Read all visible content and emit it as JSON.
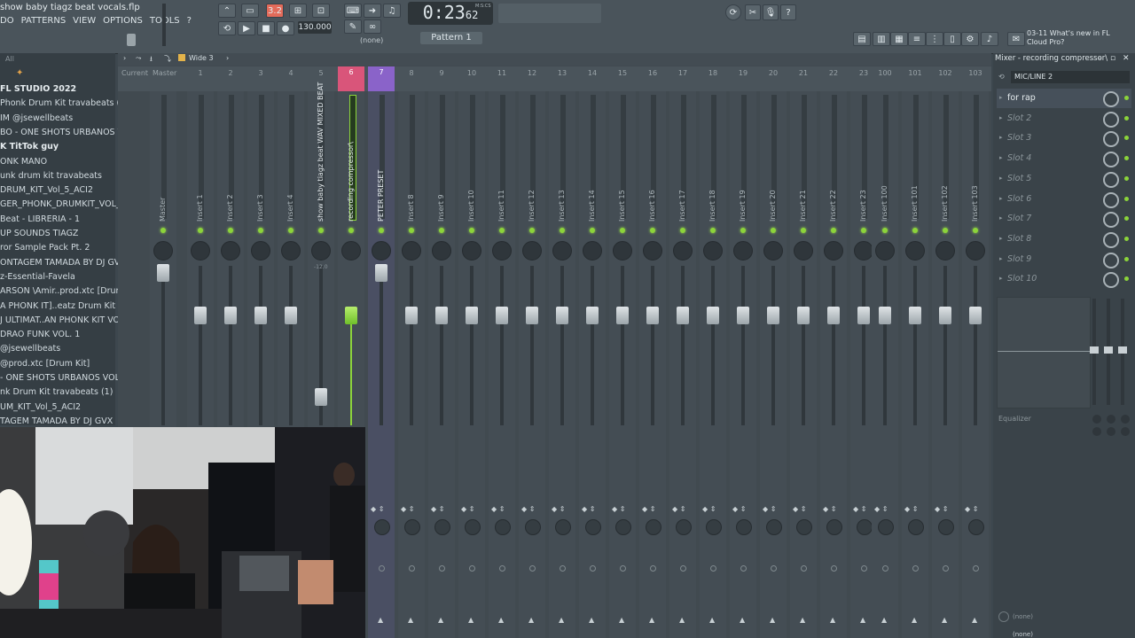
{
  "window": {
    "file_title": "show baby tiagz beat vocals.flp",
    "menu": [
      "DO",
      "PATTERNS",
      "VIEW",
      "OPTIONS",
      "TOOLS",
      "?"
    ]
  },
  "transport": {
    "time_main": "0:23",
    "time_sub": "62",
    "time_unit": "M:S:CS",
    "tempo": "130.000",
    "pattern": "Pattern 1",
    "snap": "(none)"
  },
  "news": {
    "line1": "03-11  What's new in FL",
    "line2": "Cloud Pro?"
  },
  "browser": {
    "header": "All",
    "items": [
      "FL STUDIO 2022",
      "Phonk Drum Kit travabeats (1)",
      "IM @jsewellbeats",
      "BO - ONE SHOTS URBANOS VOL. 2",
      "K TitTok guy",
      "ONK MANO",
      "unk drum kit travabeats",
      "DRUM_KIT_Vol_5_ACI2",
      "GER_PHONK_DRUMKIT_VOL_3",
      "Beat - LIBRERIA - 1",
      "UP SOUNDS TIAGZ",
      "ror Sample Pack Pt. 2",
      "ONTAGEM TAMADA BY DJ GVX",
      "z-Essential-Favela",
      "ARSON \\Amir..prod.xtc [Drum Kit]",
      "A PHONK IT]..eatz Drum Kit vol 1",
      "J ULTIMAT..AN PHONK KIT VOL. 3",
      "DRAO FUNK VOL. 1",
      "@jsewellbeats",
      "@prod.xtc [Drum Kit]",
      "- ONE SHOTS URBANOS VOL. 2",
      "nk Drum Kit travabeats (1)",
      "UM_KIT_Vol_5_ACI2",
      "TAGEM TAMADA BY DJ GVX"
    ]
  },
  "mixer": {
    "layout_label": "Wide 3",
    "current_label": "Current",
    "master_label": "Master",
    "columns": [
      "1",
      "2",
      "3",
      "4",
      "5",
      "6",
      "7",
      "8",
      "9",
      "10",
      "11",
      "12",
      "13",
      "14",
      "15",
      "16",
      "17",
      "18",
      "19",
      "20",
      "21",
      "22",
      "23",
      "100",
      "101",
      "102",
      "103"
    ],
    "track_names": [
      "Master",
      "Insert 1",
      "Insert 2",
      "Insert 3",
      "Insert 4",
      "show baby tiagz beat WAV MIXED BEAT",
      "recording compressor\\",
      "PETER PRESET",
      "Insert 8",
      "Insert 9",
      "Insert 10",
      "Insert 11",
      "Insert 12",
      "Insert 13",
      "Insert 14",
      "Insert 15",
      "Insert 16",
      "Insert 17",
      "Insert 18",
      "Insert 19",
      "Insert 20",
      "Insert 21",
      "Insert 22",
      "Insert 23",
      "Insert 100",
      "Insert 101",
      "Insert 102",
      "Insert 103"
    ],
    "selected_column": "6",
    "accent_selected": "#d9557a",
    "accent_next": "#8a63c9",
    "meter_led": "#8cd43a",
    "fader_5_value": "-12.0"
  },
  "right_panel": {
    "title": "Mixer - recording compressor\\",
    "input": "MIC/LINE 2",
    "slots": [
      "for rap",
      "Slot 2",
      "Slot 3",
      "Slot 4",
      "Slot 5",
      "Slot 6",
      "Slot 7",
      "Slot 8",
      "Slot 9",
      "Slot 10"
    ],
    "equalizer_label": "Equalizer",
    "none_top": "(none)",
    "none_bottom": "(none)"
  }
}
